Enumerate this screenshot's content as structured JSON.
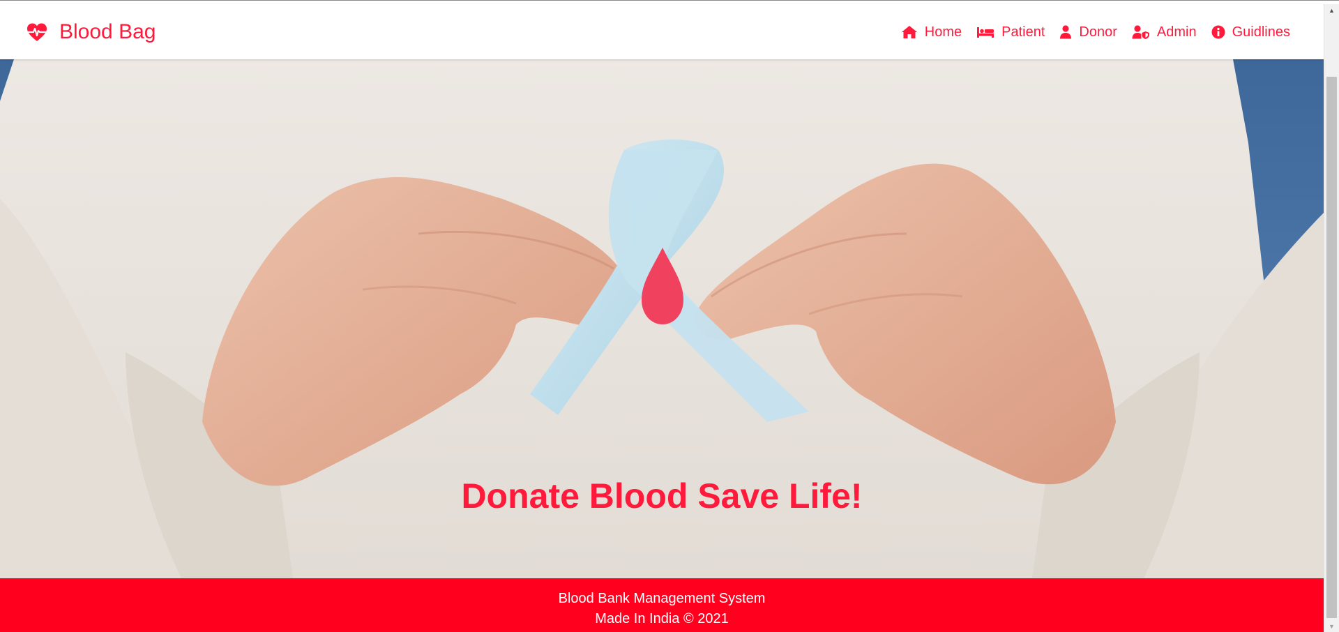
{
  "brand": {
    "name": "Blood Bag",
    "icon": "heartbeat-icon"
  },
  "nav": [
    {
      "label": "Home",
      "icon": "home-icon"
    },
    {
      "label": "Patient",
      "icon": "bed-icon"
    },
    {
      "label": "Donor",
      "icon": "user-icon"
    },
    {
      "label": "Admin",
      "icon": "user-shield-icon"
    },
    {
      "label": "Guidlines",
      "icon": "info-circle-icon"
    }
  ],
  "hero": {
    "tagline": "Donate Blood Save Life!"
  },
  "footer": {
    "line1": "Blood Bank Management System",
    "line2": "Made In India © 2021"
  },
  "colors": {
    "accent": "#ff1a3c",
    "footer_bg": "#ff001e"
  }
}
